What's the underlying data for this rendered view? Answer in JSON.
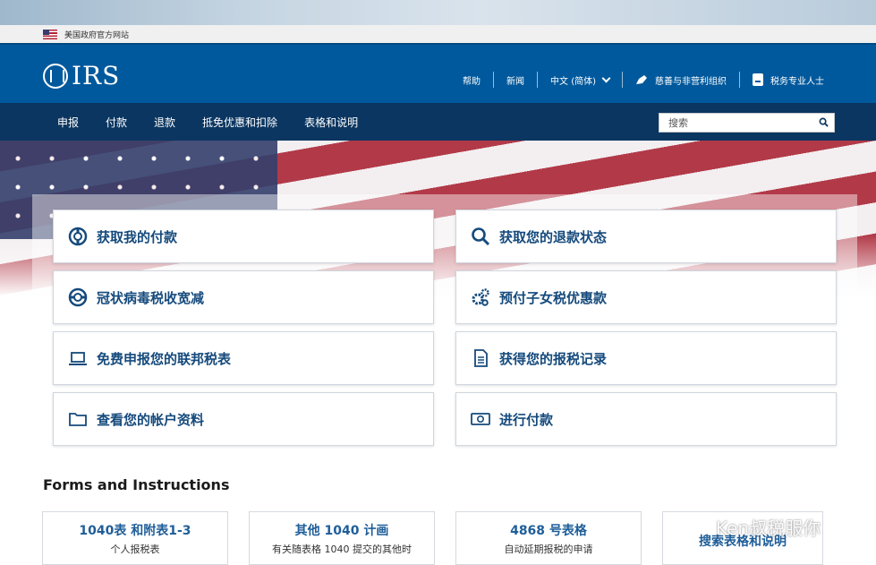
{
  "gov_banner": {
    "text": "美国政府官方网站"
  },
  "header": {
    "logo_text": "IRS",
    "util_nav": [
      {
        "label": "帮助"
      },
      {
        "label": "新闻"
      },
      {
        "label": "中文 (简体)"
      },
      {
        "label": "慈善与非营利组织",
        "icon": "pen-icon"
      },
      {
        "label": "税务专业人士",
        "icon": "id-card-icon"
      }
    ]
  },
  "main_nav": {
    "items": [
      "申报",
      "付款",
      "退款",
      "抵免优惠和扣除",
      "表格和说明"
    ],
    "search_placeholder": "搜索"
  },
  "quick_links": [
    {
      "label": "获取我的付款",
      "icon": "lifebuoy-icon"
    },
    {
      "label": "获取您的退款状态",
      "icon": "search-icon"
    },
    {
      "label": "冠状病毒税收宽减",
      "icon": "lifebuoy-icon"
    },
    {
      "label": "预付子女税优惠款",
      "icon": "gears-icon"
    },
    {
      "label": "免费申报您的联邦税表",
      "icon": "laptop-icon"
    },
    {
      "label": "获得您的报税记录",
      "icon": "document-icon"
    },
    {
      "label": "查看您的帐户资料",
      "icon": "folder-icon"
    },
    {
      "label": "进行付款",
      "icon": "money-icon"
    }
  ],
  "forms_section": {
    "title": "Forms and Instructions",
    "cards": [
      {
        "title": "1040表 和附表1-3",
        "subtitle": "个人报税表"
      },
      {
        "title": "其他 1040 计画",
        "subtitle": "有关随表格 1040 提交的其他时"
      },
      {
        "title": "4868 号表格",
        "subtitle": "自动延期报税的申请"
      },
      {
        "title": "搜索表格和说明",
        "subtitle": ""
      }
    ]
  },
  "watermark": {
    "text": "Ken叔税服你"
  },
  "colors": {
    "header_blue": "#00599c",
    "nav_navy": "#0b3661",
    "link_blue": "#154a7c"
  }
}
